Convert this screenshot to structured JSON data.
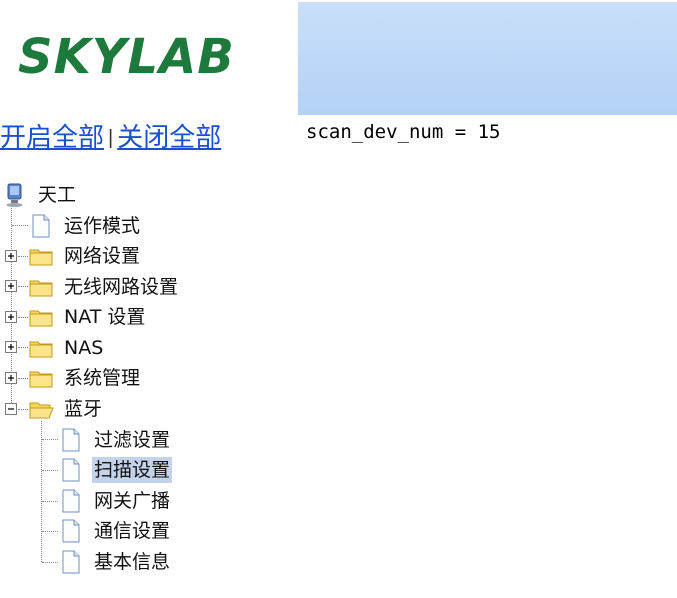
{
  "header": {
    "logo_text": "SKYLAB",
    "logo_color": "#1e7a3c",
    "banner_color": "#bcd8f8"
  },
  "tree_controls": {
    "expand_all": "开启全部",
    "separator": "|",
    "collapse_all": "关闭全部"
  },
  "console": {
    "line": "scan_dev_num = 15"
  },
  "tree": {
    "root": {
      "label": "天工",
      "icon": "computer-icon"
    },
    "items": [
      {
        "label": "运作模式",
        "icon": "page-icon",
        "toggle": "none"
      },
      {
        "label": "网络设置",
        "icon": "folder-closed-icon",
        "toggle": "plus"
      },
      {
        "label": "无线网路设置",
        "icon": "folder-closed-icon",
        "toggle": "plus"
      },
      {
        "label": "NAT 设置",
        "icon": "folder-closed-icon",
        "toggle": "plus"
      },
      {
        "label": "NAS",
        "icon": "folder-closed-icon",
        "toggle": "plus"
      },
      {
        "label": "系统管理",
        "icon": "folder-closed-icon",
        "toggle": "plus"
      },
      {
        "label": "蓝牙",
        "icon": "folder-open-icon",
        "toggle": "minus"
      }
    ],
    "bluetooth_children": [
      {
        "label": "过滤设置",
        "icon": "page-icon",
        "selected": false
      },
      {
        "label": "扫描设置",
        "icon": "page-icon",
        "selected": true
      },
      {
        "label": "网关广播",
        "icon": "page-icon",
        "selected": false
      },
      {
        "label": "通信设置",
        "icon": "page-icon",
        "selected": false
      },
      {
        "label": "基本信息",
        "icon": "page-icon",
        "selected": false
      }
    ],
    "selection_color": "#c4d3ea"
  }
}
